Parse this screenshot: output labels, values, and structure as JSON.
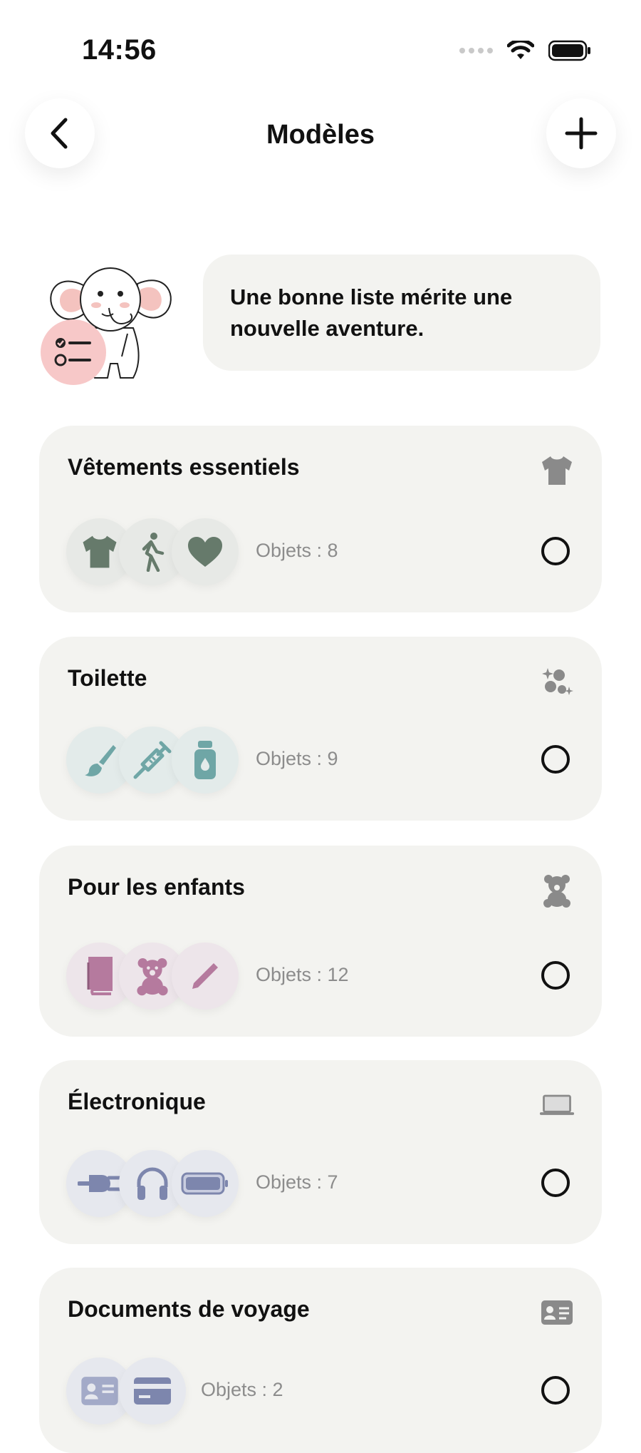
{
  "status": {
    "time": "14:56"
  },
  "header": {
    "title": "Modèles",
    "back_icon": "chevron-left-icon",
    "add_icon": "plus-icon"
  },
  "hero": {
    "message": "Une bonne liste mérite une nouvelle aventure."
  },
  "colors": {
    "green": "#667a6b",
    "teal": "#6fa6a6",
    "pink": "#b57a9e",
    "indigo": "#7d86ad",
    "card_bg": "#f3f3f0"
  },
  "templates": [
    {
      "title": "Vêtements essentiels",
      "category_icon": "tshirt-icon",
      "count": "Objets : 8",
      "icons": [
        "tshirt-icon",
        "walking-icon",
        "heart-icon"
      ]
    },
    {
      "title": "Toilette",
      "category_icon": "sparkles-icon",
      "count": "Objets : 9",
      "icons": [
        "paintbrush-icon",
        "syringe-icon",
        "bottle-icon"
      ]
    },
    {
      "title": "Pour les enfants",
      "category_icon": "teddy-bear-icon",
      "count": "Objets : 12",
      "icons": [
        "book-icon",
        "teddy-bear-icon",
        "pencil-icon"
      ]
    },
    {
      "title": "Électronique",
      "category_icon": "laptop-icon",
      "count": "Objets : 7",
      "icons": [
        "plug-icon",
        "headphones-icon",
        "battery-icon"
      ]
    },
    {
      "title": "Documents de voyage",
      "category_icon": "id-card-icon",
      "count": "Objets : 2",
      "icons": [
        "id-card-icon",
        "credit-card-icon"
      ]
    }
  ]
}
